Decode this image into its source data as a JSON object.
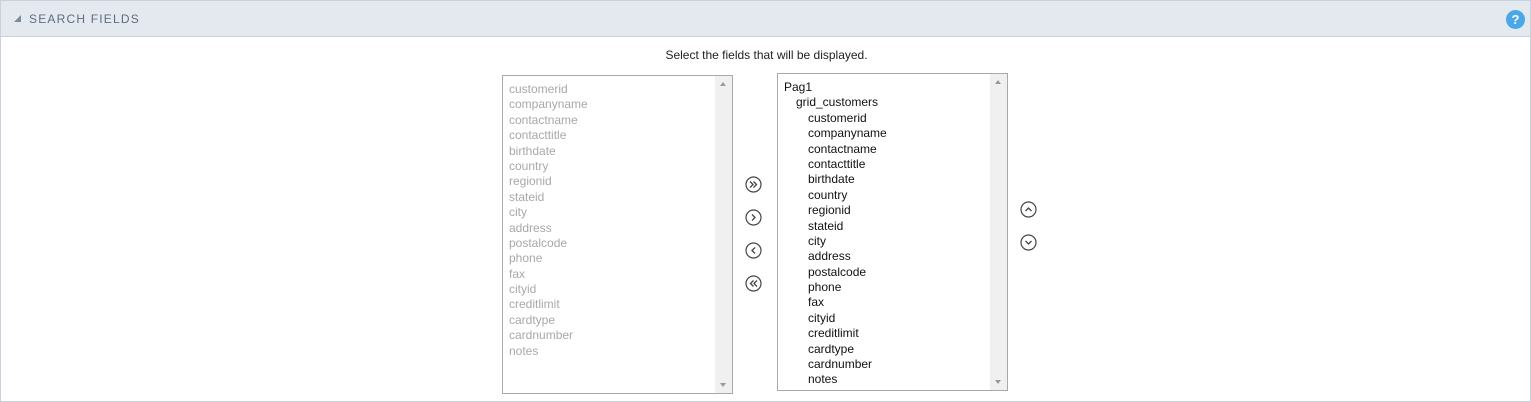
{
  "header": {
    "title": "SEARCH FIELDS",
    "help_label": "?"
  },
  "instruction": "Select the fields that will be displayed.",
  "available_fields": [
    "customerid",
    "companyname",
    "contactname",
    "contacttitle",
    "birthdate",
    "country",
    "regionid",
    "stateid",
    "city",
    "address",
    "postalcode",
    "phone",
    "fax",
    "cityid",
    "creditlimit",
    "cardtype",
    "cardnumber",
    "notes"
  ],
  "selected_tree": {
    "page": "Pag1",
    "grid": "grid_customers",
    "fields": [
      "customerid",
      "companyname",
      "contactname",
      "contacttitle",
      "birthdate",
      "country",
      "regionid",
      "stateid",
      "city",
      "address",
      "postalcode",
      "phone",
      "fax",
      "cityid",
      "creditlimit",
      "cardtype",
      "cardnumber",
      "notes"
    ]
  },
  "transfer_buttons": [
    "move-all-right-icon",
    "move-right-icon",
    "move-left-icon",
    "move-all-left-icon"
  ],
  "order_buttons": [
    "move-up-icon",
    "move-down-icon"
  ],
  "colors": {
    "header_bg": "#e4e9f0",
    "header_text": "#5e6d7e",
    "help_bg": "#4aa7e8",
    "disabled_text": "#a8a8a8"
  }
}
